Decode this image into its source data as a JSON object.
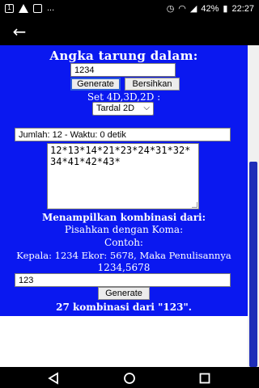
{
  "status_bar": {
    "notification_count": "1",
    "more": "...",
    "battery": "42%",
    "time": "22:27"
  },
  "webview": {
    "title": "Angka tarung dalam:",
    "number_input_value": "1234",
    "generate_label": "Generate",
    "clear_label": "Bersihkan",
    "set_label": "Set 4D,3D,2D :",
    "set_select_value": "Tardal 2D",
    "status_line": "Jumlah: 12   -   Waktu: 0 detik",
    "result_text": "12*13*14*21*23*24*31*32*34*41*42*43*",
    "combo_title": "Menampilkan kombinasi dari:",
    "separator_hint": "Pisahkan dengan Koma:",
    "example_label": "Contoh:",
    "example_text": "Kepala: 1234 Ekor: 5678, Maka Penulisannya",
    "example_value": "1234,5678",
    "combo_input_value": "123",
    "combo_generate_label": "Generate",
    "combo_result": "27 kombinasi dari \"123\"."
  }
}
